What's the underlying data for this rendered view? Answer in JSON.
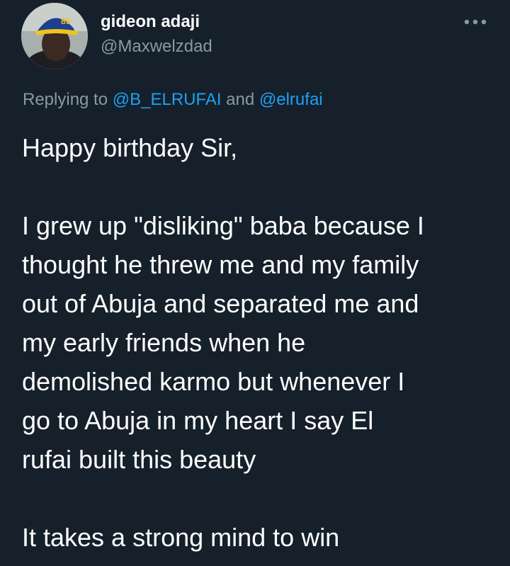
{
  "author": {
    "display_name": "gideon adaji",
    "handle": "@Maxwelzdad",
    "avatar_cap_text": "89"
  },
  "menu": {
    "icon": "more-horizontal-icon"
  },
  "reply": {
    "prefix": "Replying to ",
    "mention_1": "@B_ELRUFAI",
    "joiner": " and ",
    "mention_2": "@elrufai"
  },
  "tweet": {
    "paragraph_1": "Happy birthday Sir,",
    "paragraph_2": "I grew up \"disliking\" baba because I\nthought he threw me and my family\nout of Abuja and separated me and\nmy early friends when he\ndemolished karmo but whenever I\ngo to Abuja in my heart I say El\nrufai built this beauty",
    "paragraph_3": "It takes a strong mind to win"
  },
  "colors": {
    "background": "#15202b",
    "primary_text": "#ffffff",
    "secondary_text": "#8899a6",
    "link": "#1da1f2"
  }
}
